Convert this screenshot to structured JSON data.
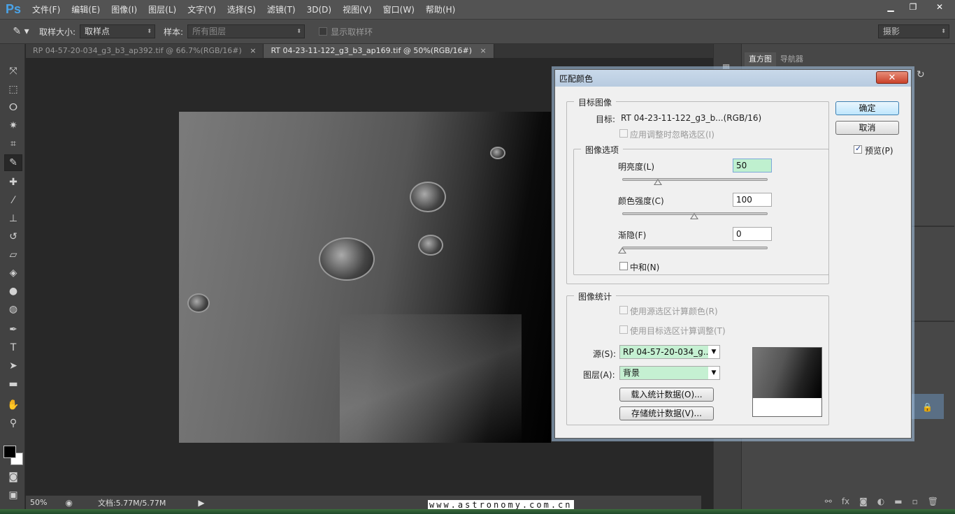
{
  "app": {
    "logo": "Ps",
    "menu": [
      "文件(F)",
      "编辑(E)",
      "图像(I)",
      "图层(L)",
      "文字(Y)",
      "选择(S)",
      "滤镜(T)",
      "3D(D)",
      "视图(V)",
      "窗口(W)",
      "帮助(H)"
    ],
    "window_controls": {
      "minimize": "▁",
      "restore": "❐",
      "close": "✕"
    }
  },
  "options_bar": {
    "sample_size_label": "取样大小:",
    "sample_size_value": "取样点",
    "sample_label": "样本:",
    "sample_value": "所有图层",
    "show_ring_label": "显示取样环",
    "workspace": "摄影"
  },
  "tools": [
    {
      "name": "move-tool",
      "glyph": "⤧"
    },
    {
      "name": "marquee-tool",
      "glyph": "⬚"
    },
    {
      "name": "lasso-tool",
      "glyph": "ⵔ"
    },
    {
      "name": "magic-wand-tool",
      "glyph": "✷"
    },
    {
      "name": "crop-tool",
      "glyph": "⌗"
    },
    {
      "name": "eyedropper-tool",
      "glyph": "✎"
    },
    {
      "name": "healing-brush-tool",
      "glyph": "✚"
    },
    {
      "name": "brush-tool",
      "glyph": "⁄"
    },
    {
      "name": "clone-stamp-tool",
      "glyph": "⊥"
    },
    {
      "name": "history-brush-tool",
      "glyph": "↺"
    },
    {
      "name": "eraser-tool",
      "glyph": "▱"
    },
    {
      "name": "paint-bucket-tool",
      "glyph": "◈"
    },
    {
      "name": "blur-tool",
      "glyph": "●"
    },
    {
      "name": "dodge-tool",
      "glyph": "◍"
    },
    {
      "name": "pen-tool",
      "glyph": "✒"
    },
    {
      "name": "type-tool",
      "glyph": "T"
    },
    {
      "name": "path-selection-tool",
      "glyph": "➤"
    },
    {
      "name": "rectangle-tool",
      "glyph": "▬"
    },
    {
      "name": "hand-tool",
      "glyph": "✋"
    },
    {
      "name": "zoom-tool",
      "glyph": "⚲"
    }
  ],
  "document_tabs": [
    {
      "label": "RP 04-57-20-034_g3_b3_ap392.tif @ 66.7%(RGB/16#)",
      "close": "×"
    },
    {
      "label": "RT 04-23-11-122_g3_b3_ap169.tif @ 50%(RGB/16#)",
      "close": "×"
    }
  ],
  "status": {
    "zoom": "50%",
    "doc_size": "文档:5.77M/5.77M",
    "watermark": "www.astronomy.com.cn"
  },
  "right_panel": {
    "tabs": [
      "直方图",
      "导航器"
    ]
  },
  "dialog": {
    "title": "匹配颜色",
    "close_glyph": "✕",
    "target_group": "目标图像",
    "target_label": "目标:",
    "target_value": "RT 04-23-11-122_g3_b...(RGB/16)",
    "ignore_selection": "应用调整时忽略选区(I)",
    "options_group": "图像选项",
    "luminance_label": "明亮度(L)",
    "luminance_value": "50",
    "luminance_level": 50,
    "intensity_label": "颜色强度(C)",
    "intensity_value": "100",
    "intensity_level": 100,
    "fade_label": "渐隐(F)",
    "fade_value": "0",
    "fade_level": 0,
    "neutralize_label": "中和(N)",
    "stats_group": "图像统计",
    "use_source_selection": "使用源选区计算颜色(R)",
    "use_target_selection": "使用目标选区计算调整(T)",
    "source_label": "源(S):",
    "source_value": "RP 04-57-20-034_g...",
    "layer_label": "图层(A):",
    "layer_value": "背景",
    "load_stats": "载入统计数据(O)...",
    "save_stats": "存储统计数据(V)...",
    "ok": "确定",
    "cancel": "取消",
    "preview": "预览(P)"
  }
}
